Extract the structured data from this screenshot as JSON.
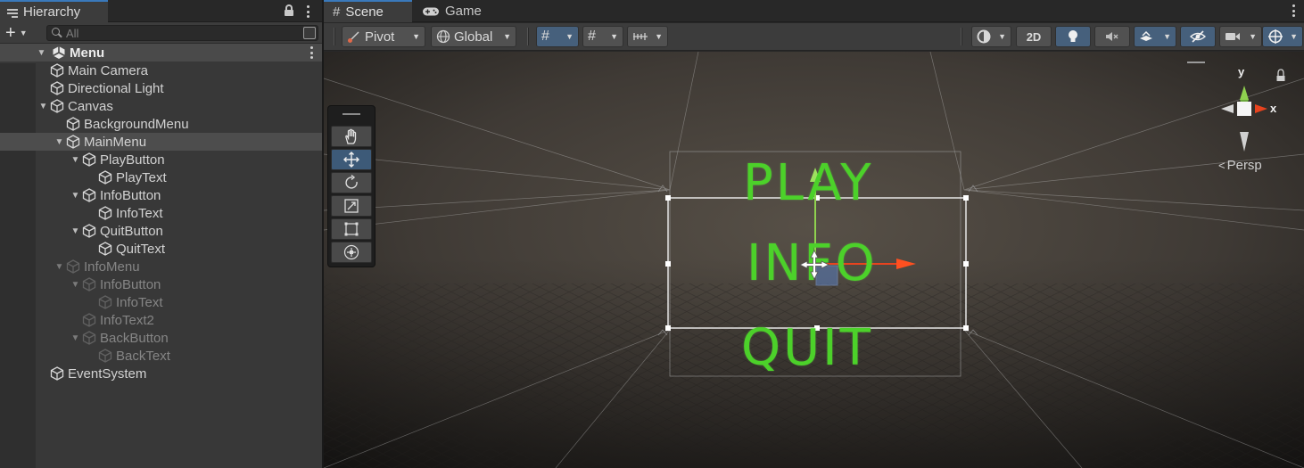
{
  "hierarchy": {
    "tab_label": "Hierarchy",
    "add_symbol": "+",
    "search_placeholder": "All",
    "scene_name": "Menu",
    "items": [
      {
        "label": "Main Camera",
        "depth": 1,
        "expand": "none",
        "active": true
      },
      {
        "label": "Directional Light",
        "depth": 1,
        "expand": "none",
        "active": true
      },
      {
        "label": "Canvas",
        "depth": 1,
        "expand": "open",
        "active": true
      },
      {
        "label": "BackgroundMenu",
        "depth": 2,
        "expand": "none",
        "active": true
      },
      {
        "label": "MainMenu",
        "depth": 2,
        "expand": "open",
        "active": true,
        "selected": true
      },
      {
        "label": "PlayButton",
        "depth": 3,
        "expand": "open",
        "active": true
      },
      {
        "label": "PlayText",
        "depth": 4,
        "expand": "none",
        "active": true
      },
      {
        "label": "InfoButton",
        "depth": 3,
        "expand": "open",
        "active": true
      },
      {
        "label": "InfoText",
        "depth": 4,
        "expand": "none",
        "active": true
      },
      {
        "label": "QuitButton",
        "depth": 3,
        "expand": "open",
        "active": true
      },
      {
        "label": "QuitText",
        "depth": 4,
        "expand": "none",
        "active": true
      },
      {
        "label": "InfoMenu",
        "depth": 2,
        "expand": "open",
        "active": false
      },
      {
        "label": "InfoButton",
        "depth": 3,
        "expand": "open",
        "active": false
      },
      {
        "label": "InfoText",
        "depth": 4,
        "expand": "none",
        "active": false
      },
      {
        "label": "InfoText2",
        "depth": 3,
        "expand": "none",
        "active": false
      },
      {
        "label": "BackButton",
        "depth": 3,
        "expand": "open",
        "active": false
      },
      {
        "label": "BackText",
        "depth": 4,
        "expand": "none",
        "active": false
      },
      {
        "label": "EventSystem",
        "depth": 1,
        "expand": "none",
        "active": true
      }
    ]
  },
  "scene": {
    "tabs": {
      "scene": "Scene",
      "game": "Game"
    },
    "toolbar": {
      "pivot": "Pivot",
      "global": "Global",
      "two_d": "2D"
    },
    "menu_words": {
      "play": "PLAY",
      "info": "INFO",
      "quit": "QUIT"
    },
    "gizmo": {
      "x": "x",
      "y": "y",
      "projection": "Persp"
    },
    "colors": {
      "accent_blue": "#3a79bb",
      "menu_text": "#4cd12a",
      "x_axis": "#e8431e",
      "y_axis": "#8fd14f"
    }
  }
}
